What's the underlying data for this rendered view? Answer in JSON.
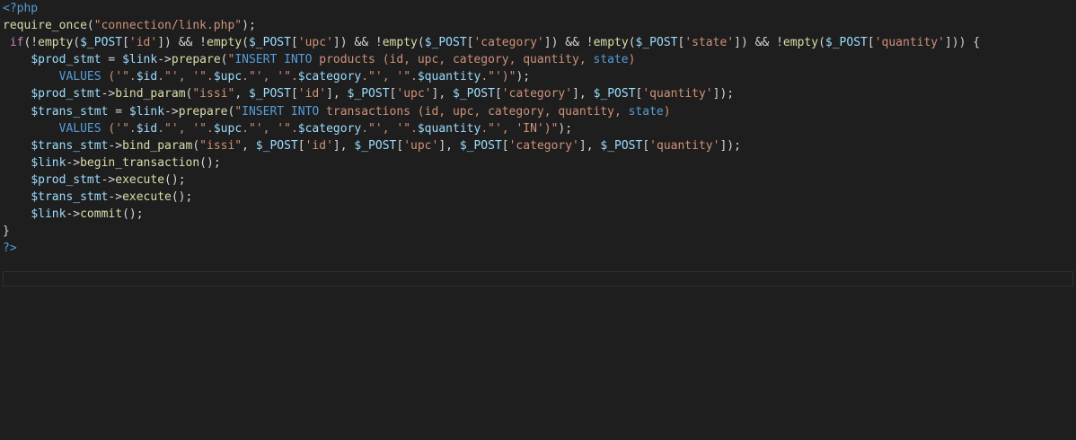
{
  "editor": {
    "language": "php",
    "theme_colors": {
      "background": "#1e1e1e",
      "tag": "#569cd6",
      "function": "#dcdcaa",
      "string": "#ce9178",
      "variable": "#9cdcfe",
      "plain": "#d4d4d4"
    },
    "lines": [
      [
        {
          "t": "tag",
          "v": "<?php"
        }
      ],
      [
        {
          "t": "func",
          "v": "require_once"
        },
        {
          "t": "plain",
          "v": "("
        },
        {
          "t": "str",
          "v": "\"connection/link.php\""
        },
        {
          "t": "plain",
          "v": ");"
        }
      ],
      [
        {
          "t": "plain",
          "v": " "
        },
        {
          "t": "kw",
          "v": "if"
        },
        {
          "t": "plain",
          "v": "(!"
        },
        {
          "t": "func",
          "v": "empty"
        },
        {
          "t": "plain",
          "v": "("
        },
        {
          "t": "var",
          "v": "$_POST"
        },
        {
          "t": "plain",
          "v": "["
        },
        {
          "t": "str",
          "v": "'id'"
        },
        {
          "t": "plain",
          "v": "]) && !"
        },
        {
          "t": "func",
          "v": "empty"
        },
        {
          "t": "plain",
          "v": "("
        },
        {
          "t": "var",
          "v": "$_POST"
        },
        {
          "t": "plain",
          "v": "["
        },
        {
          "t": "str",
          "v": "'upc'"
        },
        {
          "t": "plain",
          "v": "]) && !"
        },
        {
          "t": "func",
          "v": "empty"
        },
        {
          "t": "plain",
          "v": "("
        },
        {
          "t": "var",
          "v": "$_POST"
        },
        {
          "t": "plain",
          "v": "["
        },
        {
          "t": "str",
          "v": "'category'"
        },
        {
          "t": "plain",
          "v": "]) && !"
        },
        {
          "t": "func",
          "v": "empty"
        },
        {
          "t": "plain",
          "v": "("
        },
        {
          "t": "var",
          "v": "$_POST"
        },
        {
          "t": "plain",
          "v": "["
        },
        {
          "t": "str",
          "v": "'state'"
        },
        {
          "t": "plain",
          "v": "]) && !"
        },
        {
          "t": "func",
          "v": "empty"
        },
        {
          "t": "plain",
          "v": "("
        },
        {
          "t": "var",
          "v": "$_POST"
        },
        {
          "t": "plain",
          "v": "["
        },
        {
          "t": "str",
          "v": "'quantity'"
        },
        {
          "t": "plain",
          "v": "])) {"
        }
      ],
      [
        {
          "t": "plain",
          "v": "    "
        },
        {
          "t": "var",
          "v": "$prod_stmt"
        },
        {
          "t": "plain",
          "v": " = "
        },
        {
          "t": "var",
          "v": "$link"
        },
        {
          "t": "plain",
          "v": "->"
        },
        {
          "t": "func",
          "v": "prepare"
        },
        {
          "t": "plain",
          "v": "("
        },
        {
          "t": "str",
          "v": "\""
        },
        {
          "t": "sql",
          "v": "INSERT INTO"
        },
        {
          "t": "str",
          "v": " products (id, upc, category, quantity, "
        },
        {
          "t": "sql",
          "v": "state"
        },
        {
          "t": "str",
          "v": ")"
        }
      ],
      [
        {
          "t": "plain",
          "v": "        "
        },
        {
          "t": "sql",
          "v": "VALUES"
        },
        {
          "t": "str",
          "v": " ('\"."
        },
        {
          "t": "var",
          "v": "$id"
        },
        {
          "t": "str",
          "v": ".\"', '\"."
        },
        {
          "t": "var",
          "v": "$upc"
        },
        {
          "t": "str",
          "v": ".\"', '\"."
        },
        {
          "t": "var",
          "v": "$category"
        },
        {
          "t": "str",
          "v": ".\"', '\"."
        },
        {
          "t": "var",
          "v": "$quantity"
        },
        {
          "t": "str",
          "v": ".\"')\""
        },
        {
          "t": "plain",
          "v": ");"
        }
      ],
      [
        {
          "t": "plain",
          "v": "    "
        },
        {
          "t": "var",
          "v": "$prod_stmt"
        },
        {
          "t": "plain",
          "v": "->"
        },
        {
          "t": "func",
          "v": "bind_param"
        },
        {
          "t": "plain",
          "v": "("
        },
        {
          "t": "str",
          "v": "\"issi\""
        },
        {
          "t": "plain",
          "v": ", "
        },
        {
          "t": "var",
          "v": "$_POST"
        },
        {
          "t": "plain",
          "v": "["
        },
        {
          "t": "str",
          "v": "'id'"
        },
        {
          "t": "plain",
          "v": "], "
        },
        {
          "t": "var",
          "v": "$_POST"
        },
        {
          "t": "plain",
          "v": "["
        },
        {
          "t": "str",
          "v": "'upc'"
        },
        {
          "t": "plain",
          "v": "], "
        },
        {
          "t": "var",
          "v": "$_POST"
        },
        {
          "t": "plain",
          "v": "["
        },
        {
          "t": "str",
          "v": "'category'"
        },
        {
          "t": "plain",
          "v": "], "
        },
        {
          "t": "var",
          "v": "$_POST"
        },
        {
          "t": "plain",
          "v": "["
        },
        {
          "t": "str",
          "v": "'quantity'"
        },
        {
          "t": "plain",
          "v": "]);"
        }
      ],
      [
        {
          "t": "plain",
          "v": "    "
        },
        {
          "t": "var",
          "v": "$trans_stmt"
        },
        {
          "t": "plain",
          "v": " = "
        },
        {
          "t": "var",
          "v": "$link"
        },
        {
          "t": "plain",
          "v": "->"
        },
        {
          "t": "func",
          "v": "prepare"
        },
        {
          "t": "plain",
          "v": "("
        },
        {
          "t": "str",
          "v": "\""
        },
        {
          "t": "sql",
          "v": "INSERT INTO"
        },
        {
          "t": "str",
          "v": " transactions (id, upc, category, quantity, "
        },
        {
          "t": "sql",
          "v": "state"
        },
        {
          "t": "str",
          "v": ")"
        }
      ],
      [
        {
          "t": "plain",
          "v": "        "
        },
        {
          "t": "sql",
          "v": "VALUES"
        },
        {
          "t": "str",
          "v": " ('\"."
        },
        {
          "t": "var",
          "v": "$id"
        },
        {
          "t": "str",
          "v": ".\"', '\"."
        },
        {
          "t": "var",
          "v": "$upc"
        },
        {
          "t": "str",
          "v": ".\"', '\"."
        },
        {
          "t": "var",
          "v": "$category"
        },
        {
          "t": "str",
          "v": ".\"', '\"."
        },
        {
          "t": "var",
          "v": "$quantity"
        },
        {
          "t": "str",
          "v": ".\"', 'IN')\""
        },
        {
          "t": "plain",
          "v": ");"
        }
      ],
      [
        {
          "t": "plain",
          "v": "    "
        },
        {
          "t": "var",
          "v": "$trans_stmt"
        },
        {
          "t": "plain",
          "v": "->"
        },
        {
          "t": "func",
          "v": "bind_param"
        },
        {
          "t": "plain",
          "v": "("
        },
        {
          "t": "str",
          "v": "\"issi\""
        },
        {
          "t": "plain",
          "v": ", "
        },
        {
          "t": "var",
          "v": "$_POST"
        },
        {
          "t": "plain",
          "v": "["
        },
        {
          "t": "str",
          "v": "'id'"
        },
        {
          "t": "plain",
          "v": "], "
        },
        {
          "t": "var",
          "v": "$_POST"
        },
        {
          "t": "plain",
          "v": "["
        },
        {
          "t": "str",
          "v": "'upc'"
        },
        {
          "t": "plain",
          "v": "], "
        },
        {
          "t": "var",
          "v": "$_POST"
        },
        {
          "t": "plain",
          "v": "["
        },
        {
          "t": "str",
          "v": "'category'"
        },
        {
          "t": "plain",
          "v": "], "
        },
        {
          "t": "var",
          "v": "$_POST"
        },
        {
          "t": "plain",
          "v": "["
        },
        {
          "t": "str",
          "v": "'quantity'"
        },
        {
          "t": "plain",
          "v": "]);"
        }
      ],
      [
        {
          "t": "plain",
          "v": "    "
        },
        {
          "t": "var",
          "v": "$link"
        },
        {
          "t": "plain",
          "v": "->"
        },
        {
          "t": "func",
          "v": "begin_transaction"
        },
        {
          "t": "plain",
          "v": "();"
        }
      ],
      [
        {
          "t": "plain",
          "v": "    "
        },
        {
          "t": "var",
          "v": "$prod_stmt"
        },
        {
          "t": "plain",
          "v": "->"
        },
        {
          "t": "func",
          "v": "execute"
        },
        {
          "t": "plain",
          "v": "();"
        }
      ],
      [
        {
          "t": "plain",
          "v": "    "
        },
        {
          "t": "var",
          "v": "$trans_stmt"
        },
        {
          "t": "plain",
          "v": "->"
        },
        {
          "t": "func",
          "v": "execute"
        },
        {
          "t": "plain",
          "v": "();"
        }
      ],
      [
        {
          "t": "plain",
          "v": "    "
        },
        {
          "t": "var",
          "v": "$link"
        },
        {
          "t": "plain",
          "v": "->"
        },
        {
          "t": "func",
          "v": "commit"
        },
        {
          "t": "plain",
          "v": "();"
        }
      ],
      [
        {
          "t": "plain",
          "v": "}"
        }
      ],
      [
        {
          "t": "tag",
          "v": "?>"
        }
      ]
    ]
  }
}
